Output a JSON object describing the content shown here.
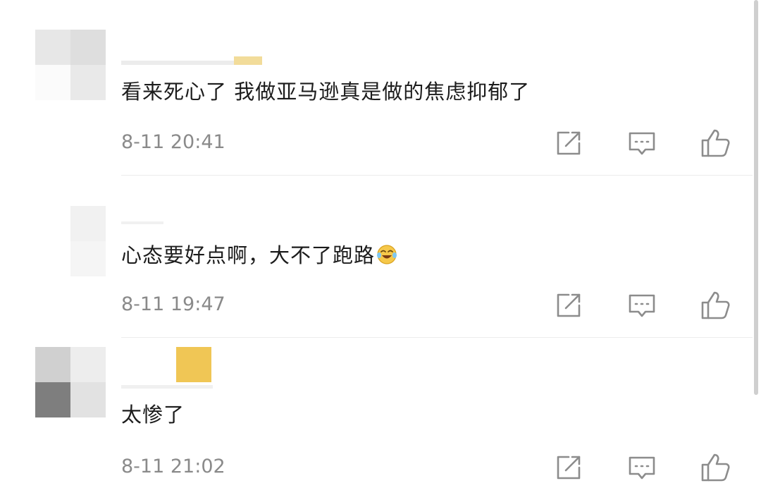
{
  "comments": [
    {
      "text": "看来死心了 我做亚马逊真是做的焦虑抑郁了",
      "time": "8-11 20:41",
      "emoji": ""
    },
    {
      "text": "心态要好点啊，大不了跑路",
      "time": "8-11 19:47",
      "emoji": "laughing-crying-emoji"
    },
    {
      "text": "太惨了",
      "time": "8-11 21:02",
      "emoji": ""
    }
  ],
  "actions": [
    "share-icon",
    "comment-icon",
    "like-icon"
  ],
  "colors": {
    "text": "#1c1c1c",
    "time": "#8a8a8a",
    "icon": "#8c8c8c",
    "divider": "#ececec",
    "badge": "#f0c655"
  }
}
